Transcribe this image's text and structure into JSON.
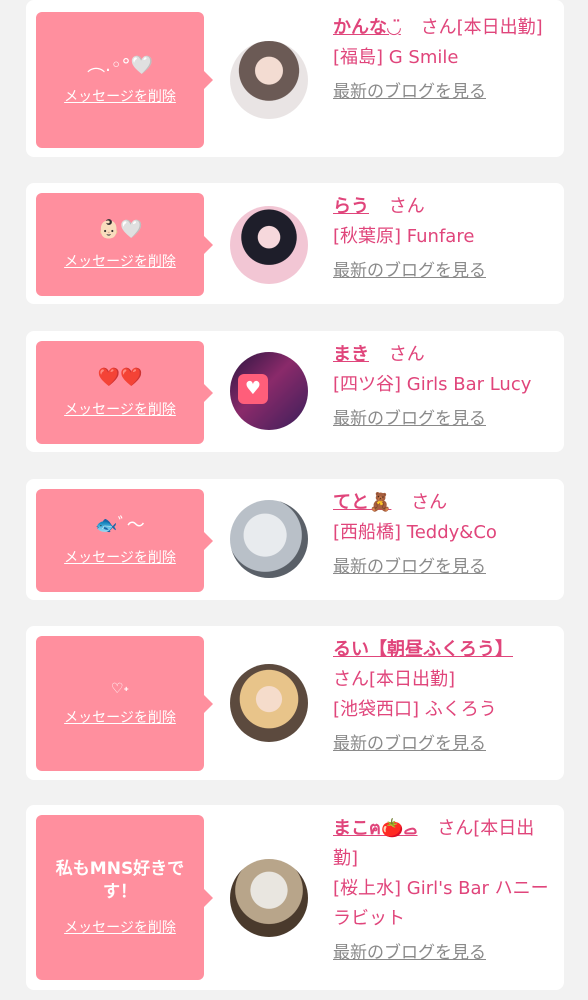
{
  "cards": [
    {
      "message": "︵.◦°🤍",
      "delete_label": "メッセージを削除",
      "name": "かんな◡̈",
      "san": "さん",
      "status": "[本日出勤]",
      "shop": "[福島] G Smile",
      "blog_label": "最新のブログを見る"
    },
    {
      "message": "👶🏻🤍",
      "delete_label": "メッセージを削除",
      "name": "らう",
      "san": "さん",
      "status": "",
      "shop": "[秋葉原] Funfare",
      "blog_label": "最新のブログを見る"
    },
    {
      "message": "❤️❤️",
      "delete_label": "メッセージを削除",
      "name": "まき",
      "san": "さん",
      "status": "",
      "shop": "[四ツ谷] Girls Bar Lucy",
      "blog_label": "最新のブログを見る"
    },
    {
      "message": "🐟ﾞ〜",
      "delete_label": "メッセージを削除",
      "name": "てと🧸",
      "san": "さん",
      "status": "",
      "shop": "[西船橋] Teddy&Co",
      "blog_label": "最新のブログを見る"
    },
    {
      "message": "♡˖",
      "delete_label": "メッセージを削除",
      "name": "るい【朝昼ふくろう】",
      "san": "さん",
      "status": "[本日出勤]",
      "shop": "[池袋西口] ふくろう",
      "blog_label": "最新のブログを見る"
    },
    {
      "message": "私もMNS好きです！",
      "delete_label": "メッセージを削除",
      "name": "まこฅ🍅ࡇ",
      "san": "さん",
      "status": "[本日出勤]",
      "shop": "[桜上水] Girl's Bar ハニーラビット",
      "blog_label": "最新のブログを見る"
    }
  ],
  "colors": {
    "bubble": "#ff8f9e",
    "accent": "#e0457b",
    "muted": "#8a8a8a",
    "background": "#f2f2f2"
  }
}
